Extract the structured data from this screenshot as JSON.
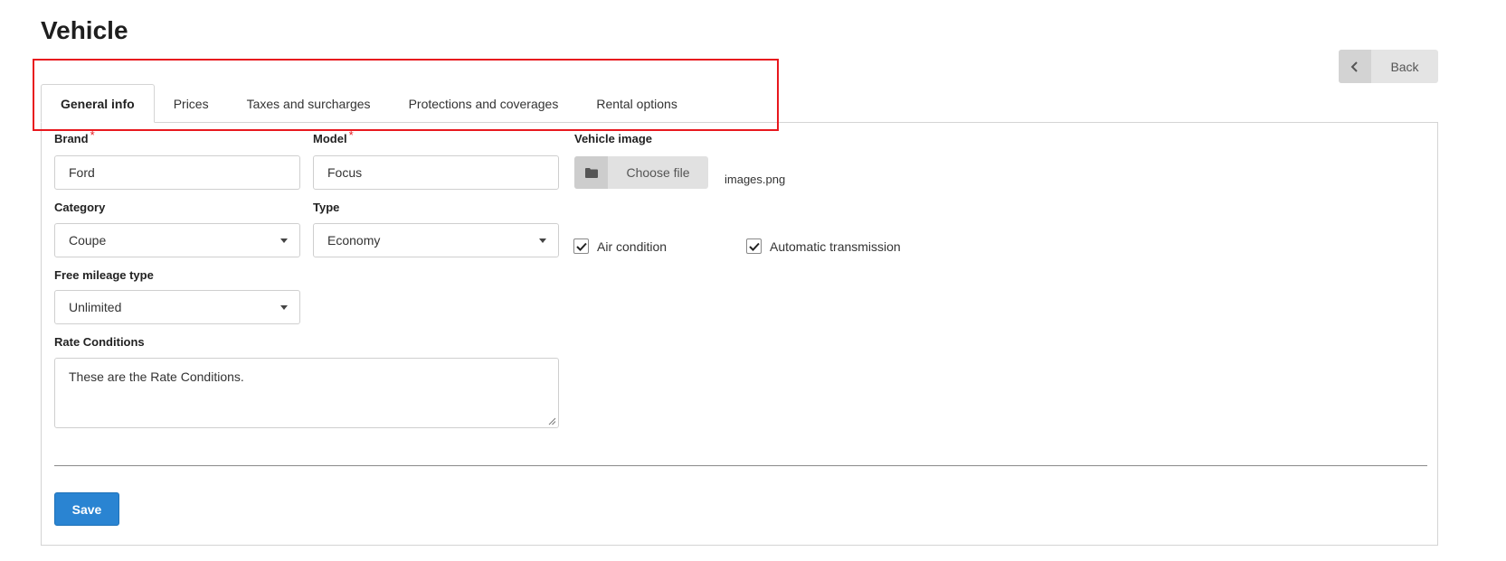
{
  "page": {
    "title": "Vehicle"
  },
  "header": {
    "back_label": "Back"
  },
  "tabs": [
    {
      "label": "General info",
      "active": true
    },
    {
      "label": "Prices",
      "active": false
    },
    {
      "label": "Taxes and surcharges",
      "active": false
    },
    {
      "label": "Protections and coverages",
      "active": false
    },
    {
      "label": "Rental options",
      "active": false
    }
  ],
  "form": {
    "brand": {
      "label": "Brand",
      "required_mark": "*",
      "value": "Ford"
    },
    "model": {
      "label": "Model",
      "required_mark": "*",
      "value": "Focus"
    },
    "vehicle_image": {
      "label": "Vehicle image",
      "button_label": "Choose file",
      "file_name": "images.png"
    },
    "category": {
      "label": "Category",
      "selected": "Coupe"
    },
    "type": {
      "label": "Type",
      "selected": "Economy"
    },
    "air_condition": {
      "label": "Air condition",
      "checked": true
    },
    "automatic_transmission": {
      "label": "Automatic transmission",
      "checked": true
    },
    "free_mileage_type": {
      "label": "Free mileage type",
      "selected": "Unlimited"
    },
    "rate_conditions": {
      "label": "Rate Conditions",
      "value": "These are the Rate Conditions."
    },
    "save_label": "Save"
  },
  "colors": {
    "accent": "#2a84d2",
    "required": "#e8181e",
    "highlight": "#e8181e"
  },
  "icons": {
    "back": "chevron-left-icon",
    "file": "folder-icon",
    "check": "checkmark-icon",
    "dropdown": "caret-down-icon"
  }
}
